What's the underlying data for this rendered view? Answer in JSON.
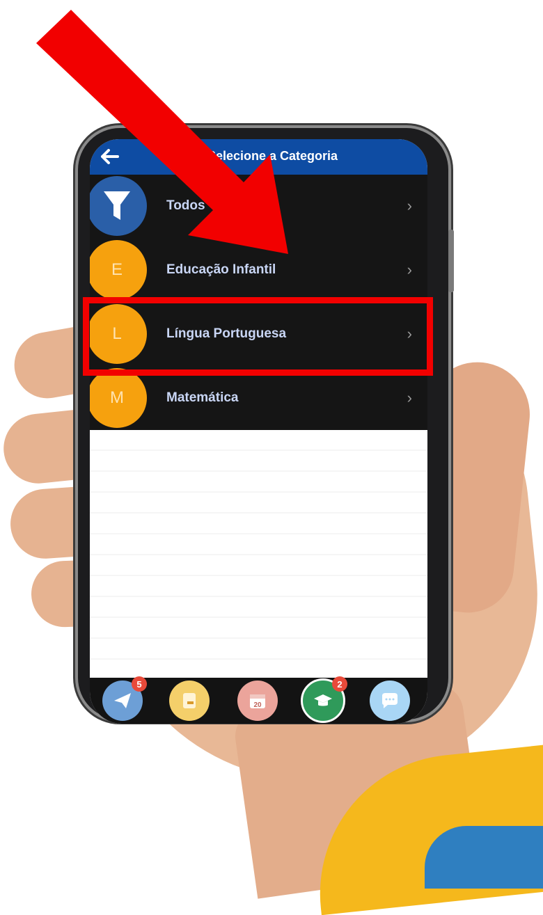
{
  "app": {
    "title": "Selecione a Categoria"
  },
  "categories": [
    {
      "label": "Todos",
      "initial": "",
      "icon": "filter-icon"
    },
    {
      "label": "Educação Infantil",
      "initial": "E"
    },
    {
      "label": "Língua Portuguesa",
      "initial": "L"
    },
    {
      "label": "Matemática",
      "initial": "M"
    }
  ],
  "bottom_nav": [
    {
      "name": "send",
      "icon": "paper-plane-icon",
      "badge": "5"
    },
    {
      "name": "notes",
      "icon": "notebook-icon",
      "badge": ""
    },
    {
      "name": "calendar",
      "icon": "calendar-icon",
      "label": "20",
      "badge": ""
    },
    {
      "name": "courses",
      "icon": "graduation-cap-icon",
      "badge": "2"
    },
    {
      "name": "chat",
      "icon": "chat-bubble-icon",
      "badge": ""
    }
  ],
  "colors": {
    "header": "#0e4ca3",
    "list_bg": "#151515",
    "avatar_orange": "#f6a10e",
    "avatar_blue": "#2a5fa8",
    "annotation_red": "#f20000"
  }
}
